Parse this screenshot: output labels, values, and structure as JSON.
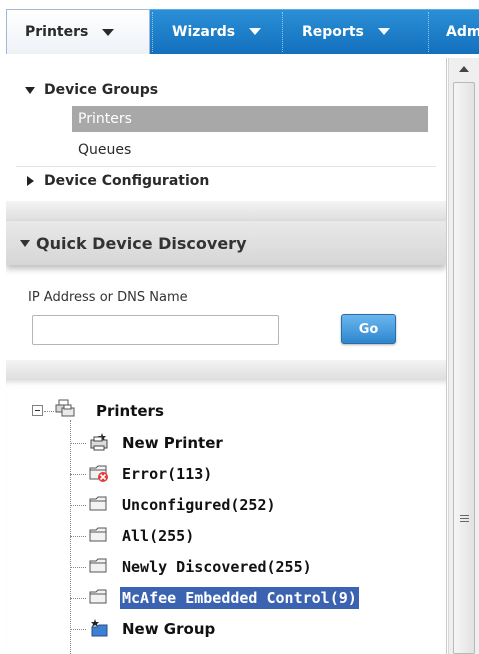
{
  "menubar": {
    "items": [
      {
        "label": "Printers"
      },
      {
        "label": "Wizards"
      },
      {
        "label": "Reports"
      },
      {
        "label": "Adm"
      }
    ]
  },
  "device_groups": {
    "header": "Device Groups",
    "items": [
      {
        "label": "Printers",
        "selected": true
      },
      {
        "label": "Queues",
        "selected": false
      }
    ]
  },
  "device_configuration": {
    "header": "Device Configuration"
  },
  "quick_discovery": {
    "title": "Quick Device Discovery",
    "field_label": "IP Address or DNS Name",
    "input_value": "",
    "input_placeholder": "",
    "go_label": "Go"
  },
  "printers_tree": {
    "root": "Printers",
    "nodes": [
      {
        "label": "New Printer",
        "icon": "new-printer-icon"
      },
      {
        "label": "Error(113)",
        "icon": "error-folder-icon"
      },
      {
        "label": "Unconfigured(252)",
        "icon": "folder-icon"
      },
      {
        "label": "All(255)",
        "icon": "folder-icon"
      },
      {
        "label": "Newly Discovered(255)",
        "icon": "folder-icon"
      },
      {
        "label": "McAfee Embedded Control(9)",
        "icon": "folder-icon",
        "selected": true
      },
      {
        "label": "New Group",
        "icon": "new-group-icon"
      }
    ]
  },
  "colors": {
    "menubar": "#1f80cc",
    "selection": "#3b63b1",
    "group_selected": "#a8a8a8",
    "go_button": "#3d92d8"
  }
}
